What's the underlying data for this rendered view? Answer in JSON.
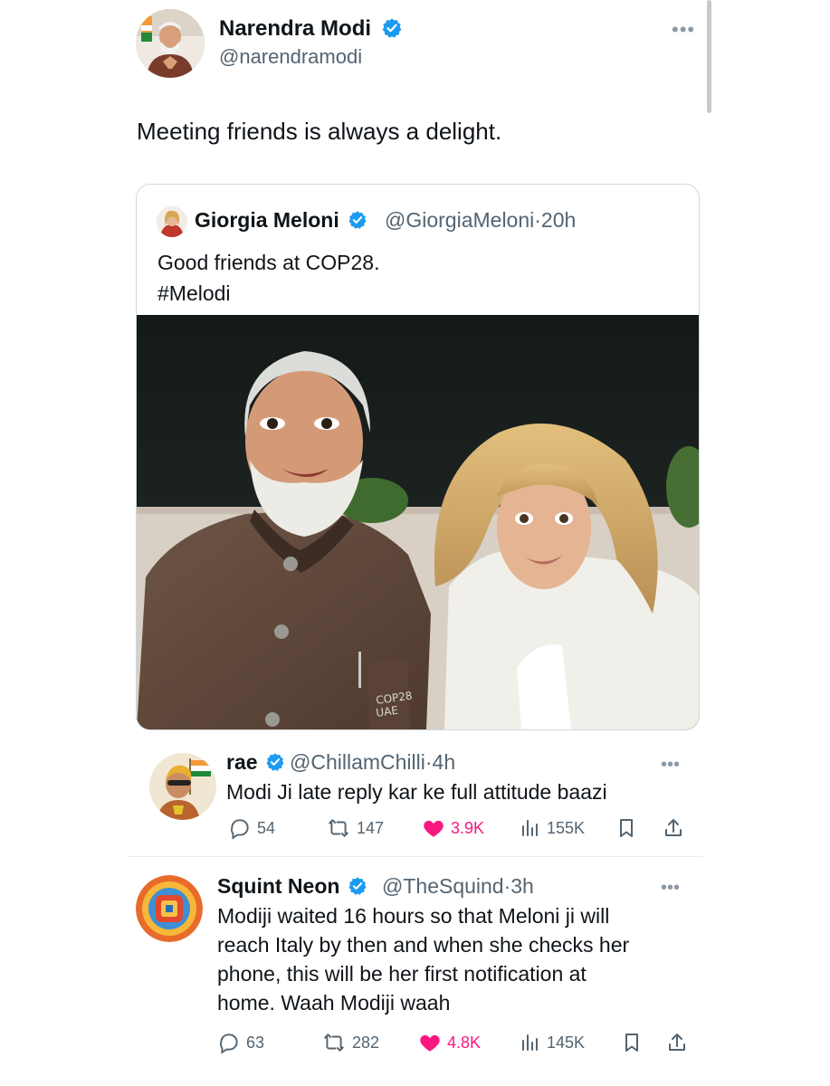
{
  "main_tweet": {
    "author_name": "Narendra Modi",
    "author_handle": "@narendramodi",
    "text": "Meeting friends is always a delight.",
    "more_label": "•••"
  },
  "quoted_tweet": {
    "author_name": "Giorgia Meloni",
    "author_handle": "@GiorgiaMeloni",
    "time": "·20h",
    "text_line1": "Good friends at COP28.",
    "text_line2": "#Melodi",
    "pin_text": "COP28\nUAE"
  },
  "replies": [
    {
      "author_name": "rae",
      "author_handle": "@ChillamChilli",
      "time": "·4h",
      "text": "Modi Ji late reply kar ke full attitude baazi",
      "comments": "54",
      "reposts": "147",
      "likes": "3.9K",
      "views": "155K",
      "more_label": "•••"
    },
    {
      "author_name": "Squint Neon",
      "author_handle": "@TheSquind",
      "time": "·3h",
      "text_lines": [
        "Modiji waited 16 hours so that Meloni ji will",
        "reach Italy by then and when she checks her",
        "phone, this will be her first notification at",
        "home. Waah Modiji waah"
      ],
      "comments": "63",
      "reposts": "282",
      "likes": "4.8K",
      "views": "145K",
      "more_label": "•••"
    }
  ],
  "icons": {
    "verified": "verified-badge-icon",
    "comment": "comment-icon",
    "repost": "repost-icon",
    "like": "heart-icon",
    "views": "views-icon",
    "bookmark": "bookmark-icon",
    "share": "share-icon"
  },
  "colors": {
    "verified_blue": "#1d9bf0",
    "like_pink": "#f91880",
    "secondary_text": "#536471"
  }
}
